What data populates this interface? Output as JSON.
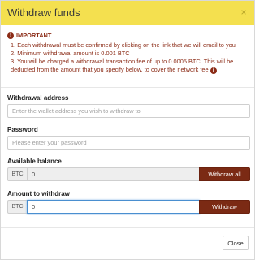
{
  "header": {
    "title": "Withdraw funds",
    "close_glyph": "×"
  },
  "important": {
    "heading": "IMPORTANT",
    "icon": "exclamation-icon",
    "items": [
      "1. Each withdrawal must be confirmed by clicking on the link that we will email to you",
      "2. Minimum withdrawal amount is 0.001 BTC",
      "3. You will be charged a withdrawal transaction fee of up to 0.0005 BTC. This will be deducted from the amount that you specify below, to cover the network fee"
    ],
    "info_icon": "info-icon"
  },
  "withdrawal_address": {
    "label": "Withdrawal address",
    "placeholder": "Enter the wallet address you wish to withdraw to",
    "value": ""
  },
  "password": {
    "label": "Password",
    "placeholder": "Please enter your password",
    "value": ""
  },
  "available_balance": {
    "label": "Available balance",
    "currency": "BTC",
    "value": "0",
    "button_label": "Withdraw all"
  },
  "amount": {
    "label": "Amount to withdraw",
    "currency": "BTC",
    "value": "0",
    "button_label": "Withdraw"
  },
  "footer": {
    "close_label": "Close"
  },
  "colors": {
    "header_bg": "#f4e04f",
    "accent_button": "#7b2a14",
    "important_text": "#8b2b16"
  }
}
